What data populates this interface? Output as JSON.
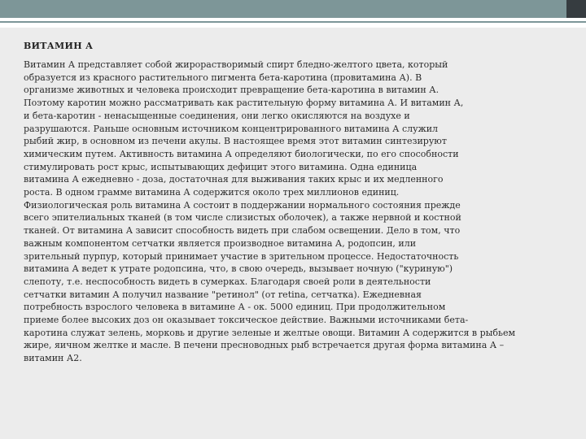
{
  "title": "ВИТАМИН А",
  "lines": [
    "Витамин А представляет собой жирорастворимый спирт бледно-желтого цвета, который",
    "образуется из красного растительного пигмента бета-каротина (провитамина А). В",
    "организме животных и человека происходит превращение бета-каротина в витамин А.",
    "Поэтому каротин можно рассматривать как растительную форму витамина А. И витамин А,",
    "и бета-каротин - ненасыщенные соединения, они легко окисляются на воздухе и",
    "разрушаются. Раньше основным источником концентрированного витамина А служил",
    "рыбий жир, в основном из печени акулы. В настоящее время этот витамин синтезируют",
    "химическим путем. Активность витамина А определяют биологически, по его способности",
    "стимулировать рост крыс, испытывающих дефицит этого витамина. Одна единица",
    "витамина А ежедневно - доза, достаточная для выживания таких крыс и их медленного",
    "роста. В одном грамме витамина А содержится около трех миллионов единиц.",
    "Физиологическая роль витамина А состоит в поддержании нормального состояния прежде",
    "всего эпителиальных тканей (в том числе слизистых оболочек), а также нервной и костной",
    "тканей. От витамина А зависит способность видеть при слабом освещении. Дело в том, что",
    "важным компонентом сетчатки является производное витамина А, родопсин, или",
    "зрительный пурпур, который принимает участие в зрительном процессе. Недостаточность",
    "витамина А ведет к утрате родопсина, что, в свою очередь, вызывает ночную (\"куриную\")",
    "слепоту, т.е. неспособность видеть в сумерках. Благодаря своей роли в деятельности",
    "сетчатки витамин А получил название \"ретинол\" (от retina, сетчатка). Ежедневная",
    "потребность взрослого человека в витамине А - ок. 5000 единиц. При продолжительном",
    "приеме более высоких доз он оказывает токсическое действие. Важными источниками бета-",
    "каротина служат зелень, морковь и другие зеленые и желтые овощи. Витамин А содержится в рыбьем",
    "жире, яичном желтке и масле. В печени пресноводных рыб встречается другая форма витамина А –",
    "витамин А2."
  ],
  "colors": {
    "band": "#7d9698",
    "band_dark": "#363c40",
    "background": "#ececec"
  }
}
